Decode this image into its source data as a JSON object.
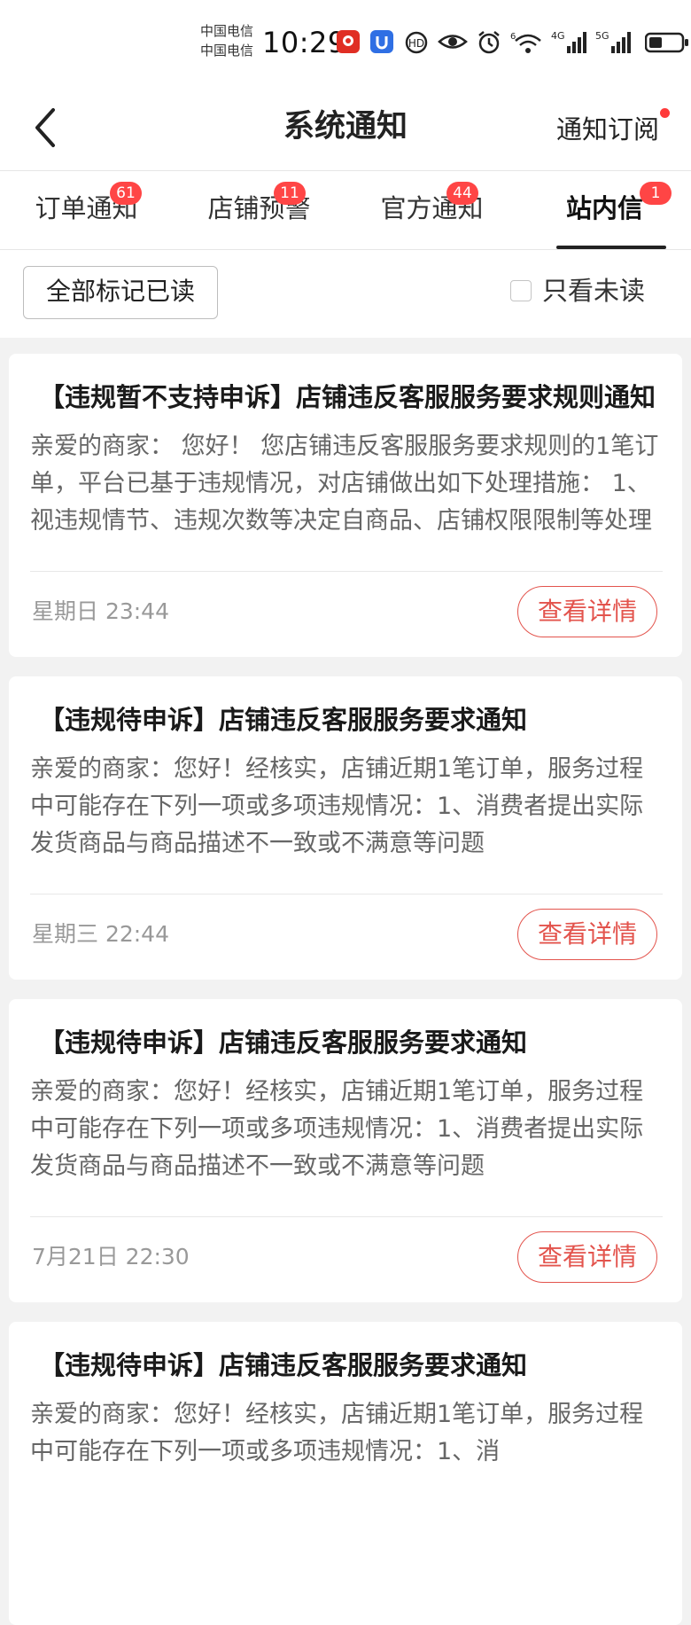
{
  "status_bar": {
    "carrier_1": "中国电信",
    "carrier_2": "中国电信",
    "time": "10:29",
    "icons": [
      "pinduoduo-app-icon",
      "u-app-icon",
      "hd-call-icon",
      "eye-comfort-icon",
      "alarm-icon",
      "wifi-icon",
      "signal-4g-icon",
      "signal-5g-icon",
      "battery-icon"
    ],
    "network_labels": [
      "6",
      "4G",
      "5G"
    ]
  },
  "nav": {
    "title": "系统通知",
    "subscribe_label": "通知订阅",
    "subscribe_dot_color": "#ff3a3a"
  },
  "tabs": [
    {
      "label": "订单通知",
      "badge": "61",
      "active": false
    },
    {
      "label": "店铺预警",
      "badge": "11",
      "active": false
    },
    {
      "label": "官方通知",
      "badge": "44",
      "active": false
    },
    {
      "label": "站内信",
      "badge": "1",
      "active": true
    }
  ],
  "filter": {
    "mark_all_read_label": "全部标记已读",
    "unread_only_label": "只看未读",
    "unread_only_checked": false
  },
  "colors": {
    "accent": "#e3544d",
    "badge": "#ff4545"
  },
  "messages": [
    {
      "title": "【违规暂不支持申诉】店铺违反客服服务要求规则通知",
      "body": "亲爱的商家：  您好！  您店铺违反客服服务要求规则的1笔订单，平台已基于违规情况，对店铺做出如下处理措施：  1、视违规情节、违规次数等决定自商品、店铺权限限制等处理",
      "time": "星期日 23:44",
      "action": "查看详情"
    },
    {
      "title": "【违规待申诉】店铺违反客服服务要求通知",
      "body": "亲爱的商家：您好！经核实，店铺近期1笔订单，服务过程中可能存在下列一项或多项违规情况：1、消费者提出实际发货商品与商品描述不一致或不满意等问题",
      "time": "星期三 22:44",
      "action": "查看详情"
    },
    {
      "title": "【违规待申诉】店铺违反客服服务要求通知",
      "body": "亲爱的商家：您好！经核实，店铺近期1笔订单，服务过程中可能存在下列一项或多项违规情况：1、消费者提出实际发货商品与商品描述不一致或不满意等问题",
      "time": "7月21日 22:30",
      "action": "查看详情"
    },
    {
      "title": "【违规待申诉】店铺违反客服服务要求通知",
      "body": "亲爱的商家：您好！经核实，店铺近期1笔订单，服务过程中可能存在下列一项或多项违规情况：1、消",
      "time": "",
      "action": ""
    }
  ]
}
